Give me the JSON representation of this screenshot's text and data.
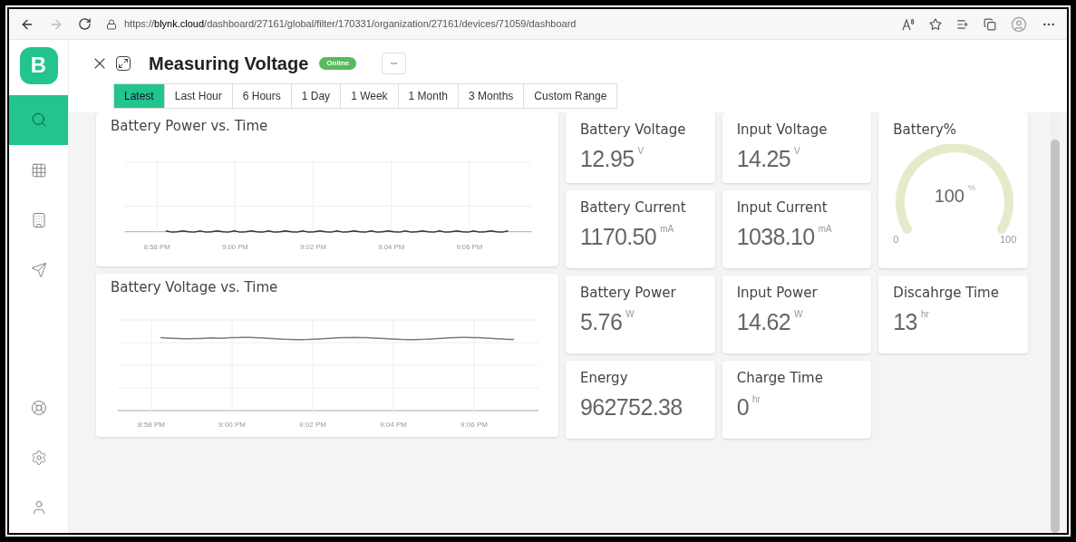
{
  "browser": {
    "url_prefix": "https://",
    "url_domain": "blynk.cloud",
    "url_path": "/dashboard/27161/global/filter/170331/organization/27161/devices/71059/dashboard"
  },
  "sidebar": {
    "logo": "B",
    "items": [
      {
        "kind": "search",
        "selected": true
      },
      {
        "kind": "apps",
        "selected": false
      },
      {
        "kind": "building",
        "selected": false
      },
      {
        "kind": "send",
        "selected": false
      },
      {
        "kind": "help",
        "selected": false
      },
      {
        "kind": "settings",
        "selected": false
      },
      {
        "kind": "user",
        "selected": false
      }
    ]
  },
  "header": {
    "title": "Measuring Voltage",
    "status": "Online",
    "more": "•••"
  },
  "tabs": [
    {
      "label": "Latest",
      "selected": true
    },
    {
      "label": "Last Hour",
      "selected": false
    },
    {
      "label": "6 Hours",
      "selected": false
    },
    {
      "label": "1 Day",
      "selected": false
    },
    {
      "label": "1 Week",
      "selected": false
    },
    {
      "label": "1 Month",
      "selected": false
    },
    {
      "label": "3 Months",
      "selected": false
    },
    {
      "label": "Custom Range",
      "selected": false
    }
  ],
  "charts": [
    {
      "title": "Battery Power vs. Time",
      "kind": "noisy",
      "x_labels": [
        "8:58 PM",
        "9:00 PM",
        "9:02 PM",
        "9:04 PM",
        "9:06 PM"
      ]
    },
    {
      "title": "Battery Voltage vs. Time",
      "kind": "smooth",
      "x_labels": [
        "8:58 PM",
        "9:00 PM",
        "9:02 PM",
        "9:04 PM",
        "9:06 PM"
      ]
    }
  ],
  "tiles": [
    {
      "label": "Battery Voltage",
      "value": "12.95",
      "unit": "V"
    },
    {
      "label": "Input Voltage",
      "value": "14.25",
      "unit": "V"
    },
    {
      "label": "Battery Current",
      "value": "1170.50",
      "unit": "mA"
    },
    {
      "label": "Input Current",
      "value": "1038.10",
      "unit": "mA"
    },
    {
      "label": "Battery Power",
      "value": "5.76",
      "unit": "W"
    },
    {
      "label": "Input Power",
      "value": "14.62",
      "unit": "W"
    },
    {
      "label": "Energy",
      "value": "962752.38"
    },
    {
      "label": "Charge Time",
      "value": "0",
      "unit": "hr"
    }
  ],
  "gauge": {
    "label": "Battery%",
    "value": "100",
    "unit": "%",
    "min": "0",
    "max": "100",
    "level": 1
  },
  "discharge": {
    "label": "Discahrge Time",
    "value": "13",
    "unit": "hr"
  }
}
